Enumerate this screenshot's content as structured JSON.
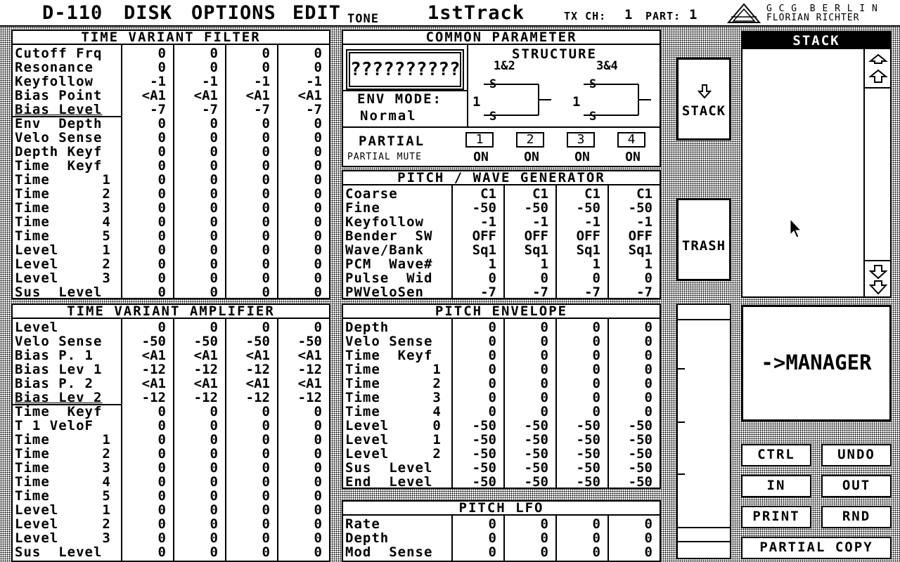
{
  "menubar": {
    "items": [
      "D-110",
      "DISK",
      "OPTIONS",
      "EDIT"
    ],
    "tone_label": "TONE",
    "tone_name": "1stTrack",
    "tx_ch_label": "TX CH:",
    "tx_ch_value": "1",
    "part_label": "PART:",
    "part_value": "1",
    "logo_line1": "G C G  B E R L I N",
    "logo_line2": "FLORIAN RICHTER"
  },
  "tvf": {
    "title": "TIME VARIANT FILTER",
    "rows": [
      {
        "label": "Cutoff Frq",
        "values": [
          "0",
          "0",
          "0",
          "0"
        ]
      },
      {
        "label": "Resonance",
        "values": [
          "0",
          "0",
          "0",
          "0"
        ]
      },
      {
        "label": "Keyfollow",
        "values": [
          "-1",
          "-1",
          "-1",
          "-1"
        ]
      },
      {
        "label": "Bias Point",
        "values": [
          "<A1",
          "<A1",
          "<A1",
          "<A1"
        ]
      },
      {
        "label": "Bias Level",
        "values": [
          "-7",
          "-7",
          "-7",
          "-7"
        ]
      },
      {
        "label": "Env  Depth",
        "values": [
          "0",
          "0",
          "0",
          "0"
        ]
      },
      {
        "label": "Velo Sense",
        "values": [
          "0",
          "0",
          "0",
          "0"
        ]
      },
      {
        "label": "Depth Keyf",
        "values": [
          "0",
          "0",
          "0",
          "0"
        ]
      },
      {
        "label": "Time  Keyf",
        "values": [
          "0",
          "0",
          "0",
          "0"
        ]
      },
      {
        "label": "Time      1",
        "values": [
          "0",
          "0",
          "0",
          "0"
        ]
      },
      {
        "label": "Time      2",
        "values": [
          "0",
          "0",
          "0",
          "0"
        ]
      },
      {
        "label": "Time      3",
        "values": [
          "0",
          "0",
          "0",
          "0"
        ]
      },
      {
        "label": "Time      4",
        "values": [
          "0",
          "0",
          "0",
          "0"
        ]
      },
      {
        "label": "Time      5",
        "values": [
          "0",
          "0",
          "0",
          "0"
        ]
      },
      {
        "label": "Level     1",
        "values": [
          "0",
          "0",
          "0",
          "0"
        ]
      },
      {
        "label": "Level     2",
        "values": [
          "0",
          "0",
          "0",
          "0"
        ]
      },
      {
        "label": "Level     3",
        "values": [
          "0",
          "0",
          "0",
          "0"
        ]
      },
      {
        "label": "Sus  Level",
        "values": [
          "0",
          "0",
          "0",
          "0"
        ]
      }
    ]
  },
  "tva": {
    "title": "TIME VARIANT AMPLIFIER",
    "rows": [
      {
        "label": "Level",
        "values": [
          "0",
          "0",
          "0",
          "0"
        ]
      },
      {
        "label": "Velo Sense",
        "values": [
          "-50",
          "-50",
          "-50",
          "-50"
        ]
      },
      {
        "label": "Bias P. 1",
        "values": [
          "<A1",
          "<A1",
          "<A1",
          "<A1"
        ]
      },
      {
        "label": "Bias Lev 1",
        "values": [
          "-12",
          "-12",
          "-12",
          "-12"
        ]
      },
      {
        "label": "Bias P. 2",
        "values": [
          "<A1",
          "<A1",
          "<A1",
          "<A1"
        ]
      },
      {
        "label": "Bias Lev 2",
        "values": [
          "-12",
          "-12",
          "-12",
          "-12"
        ]
      },
      {
        "label": "Time  Keyf",
        "values": [
          "0",
          "0",
          "0",
          "0"
        ]
      },
      {
        "label": "T 1 VeloF",
        "values": [
          "0",
          "0",
          "0",
          "0"
        ]
      },
      {
        "label": "Time      1",
        "values": [
          "0",
          "0",
          "0",
          "0"
        ]
      },
      {
        "label": "Time      2",
        "values": [
          "0",
          "0",
          "0",
          "0"
        ]
      },
      {
        "label": "Time      3",
        "values": [
          "0",
          "0",
          "0",
          "0"
        ]
      },
      {
        "label": "Time      4",
        "values": [
          "0",
          "0",
          "0",
          "0"
        ]
      },
      {
        "label": "Time      5",
        "values": [
          "0",
          "0",
          "0",
          "0"
        ]
      },
      {
        "label": "Level     1",
        "values": [
          "0",
          "0",
          "0",
          "0"
        ]
      },
      {
        "label": "Level     2",
        "values": [
          "0",
          "0",
          "0",
          "0"
        ]
      },
      {
        "label": "Level     3",
        "values": [
          "0",
          "0",
          "0",
          "0"
        ]
      },
      {
        "label": "Sus  Level",
        "values": [
          "0",
          "0",
          "0",
          "0"
        ]
      }
    ]
  },
  "common": {
    "title": "COMMON PARAMETER",
    "tone_name_box": "??????????",
    "structure_label": "STRUCTURE",
    "struct_12": "1&2",
    "struct_34": "3&4",
    "struct_s": "S",
    "struct_1": "1",
    "env_mode_label": "ENV MODE:",
    "env_mode_value": "Normal",
    "partial_label": "PARTIAL",
    "partials": [
      "1",
      "2",
      "3",
      "4"
    ],
    "partial_mute_label": "PARTIAL MUTE",
    "mutes": [
      "ON",
      "ON",
      "ON",
      "ON"
    ]
  },
  "pwg": {
    "title": "PITCH / WAVE GENERATOR",
    "rows": [
      {
        "label": "Coarse",
        "values": [
          "C1",
          "C1",
          "C1",
          "C1"
        ]
      },
      {
        "label": "Fine",
        "values": [
          "-50",
          "-50",
          "-50",
          "-50"
        ]
      },
      {
        "label": "Keyfollow",
        "values": [
          "-1",
          "-1",
          "-1",
          "-1"
        ]
      },
      {
        "label": "Bender  SW",
        "values": [
          "OFF",
          "OFF",
          "OFF",
          "OFF"
        ]
      },
      {
        "label": "Wave/Bank",
        "values": [
          "Sq1",
          "Sq1",
          "Sq1",
          "Sq1"
        ]
      },
      {
        "label": "PCM  Wave#",
        "values": [
          "1",
          "1",
          "1",
          "1"
        ]
      },
      {
        "label": "Pulse  Wid",
        "values": [
          "0",
          "0",
          "0",
          "0"
        ]
      },
      {
        "label": "PWVeloSen",
        "values": [
          "-7",
          "-7",
          "-7",
          "-7"
        ]
      }
    ]
  },
  "penv": {
    "title": "PITCH ENVELOPE",
    "rows": [
      {
        "label": "Depth",
        "values": [
          "0",
          "0",
          "0",
          "0"
        ]
      },
      {
        "label": "Velo Sense",
        "values": [
          "0",
          "0",
          "0",
          "0"
        ]
      },
      {
        "label": "Time  Keyf",
        "values": [
          "0",
          "0",
          "0",
          "0"
        ]
      },
      {
        "label": "Time      1",
        "values": [
          "0",
          "0",
          "0",
          "0"
        ]
      },
      {
        "label": "Time      2",
        "values": [
          "0",
          "0",
          "0",
          "0"
        ]
      },
      {
        "label": "Time      3",
        "values": [
          "0",
          "0",
          "0",
          "0"
        ]
      },
      {
        "label": "Time      4",
        "values": [
          "0",
          "0",
          "0",
          "0"
        ]
      },
      {
        "label": "Level     0",
        "values": [
          "-50",
          "-50",
          "-50",
          "-50"
        ]
      },
      {
        "label": "Level     1",
        "values": [
          "-50",
          "-50",
          "-50",
          "-50"
        ]
      },
      {
        "label": "Level     2",
        "values": [
          "-50",
          "-50",
          "-50",
          "-50"
        ]
      },
      {
        "label": "Sus  Level",
        "values": [
          "-50",
          "-50",
          "-50",
          "-50"
        ]
      },
      {
        "label": "End  Level",
        "values": [
          "-50",
          "-50",
          "-50",
          "-50"
        ]
      }
    ]
  },
  "plfo": {
    "title": "PITCH LFO",
    "rows": [
      {
        "label": "Rate",
        "values": [
          "0",
          "0",
          "0",
          "0"
        ]
      },
      {
        "label": "Depth",
        "values": [
          "0",
          "0",
          "0",
          "0"
        ]
      },
      {
        "label": "Mod  Sense",
        "values": [
          "0",
          "0",
          "0",
          "0"
        ]
      }
    ]
  },
  "side": {
    "stack_button": "STACK",
    "trash_button": "TRASH",
    "stack_title": "STACK",
    "manager_button": "->MANAGER",
    "ctrl_button": "CTRL",
    "undo_button": "UNDO",
    "in_button": "IN",
    "out_button": "OUT",
    "print_button": "PRINT",
    "rnd_button": "RND",
    "partial_copy_button": "PARTIAL COPY"
  }
}
